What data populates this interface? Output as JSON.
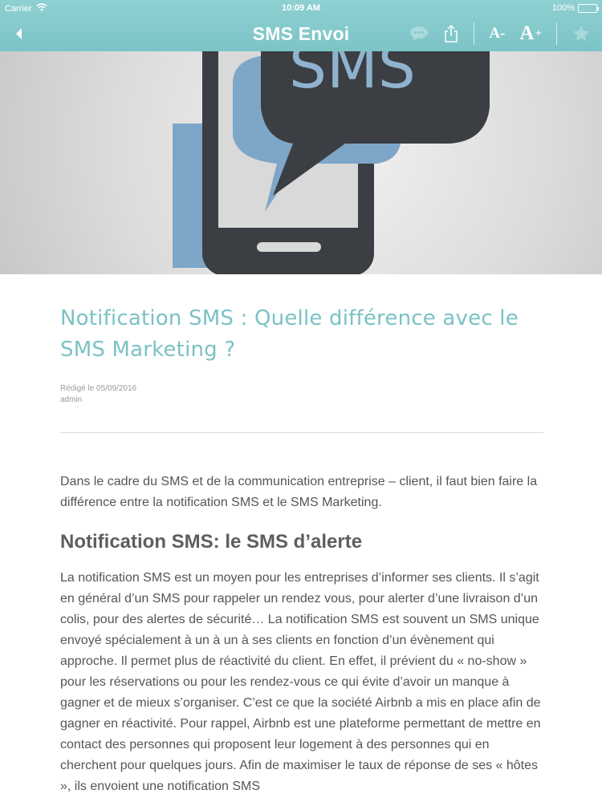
{
  "status_bar": {
    "carrier": "Carrier",
    "time": "10:09 AM",
    "battery": "100%"
  },
  "nav": {
    "title": "SMS Envoi",
    "font_decrease": "A-",
    "font_increase_letter": "A",
    "font_increase_symbol": "+"
  },
  "hero": {
    "logo_text": "SMS"
  },
  "article": {
    "title": "Notification SMS : Quelle différence avec le SMS Marketing ?",
    "meta_date": "Rédigé le 05/09/2016",
    "meta_author": "admin",
    "intro": "Dans le cadre du SMS et de la communication entreprise – client, il faut bien faire la différence entre la notification SMS et le SMS Marketing.",
    "heading": "Notification SMS: le SMS d’alerte",
    "paragraph": "La notification SMS est un moyen pour les entreprises d’informer ses clients. Il s’agit en général d’un SMS pour rappeler un rendez vous, pour alerter d’une livraison d’un colis, pour des alertes de sécurité… La notification SMS est souvent un SMS unique envoyé spécialement à un à un à ses clients en fonction d’un évènement qui approche. Il permet plus de réactivité du client. En effet, il prévient du « no-show » pour les réservations ou pour les rendez-vous ce qui évite d’avoir un manque à gagner et de mieux s’organiser. C’est ce que la société Airbnb a mis en place afin de gagner en réactivité. Pour rappel, Airbnb est une plateforme permettant de mettre en contact des personnes qui proposent leur logement à des personnes qui en cherchent pour quelques jours. Afin de maximiser le taux de réponse de ses « hôtes », ils envoient une notification SMS"
  },
  "colors": {
    "nav_bg": "#7cc4c6",
    "title": "#7bc2c5",
    "phone": "#3b3e42",
    "bubble_light": "#7ea6c8"
  },
  "icons": [
    "wifi-icon",
    "battery-icon",
    "back-chevron-icon",
    "comment-icon",
    "share-icon",
    "star-icon"
  ]
}
